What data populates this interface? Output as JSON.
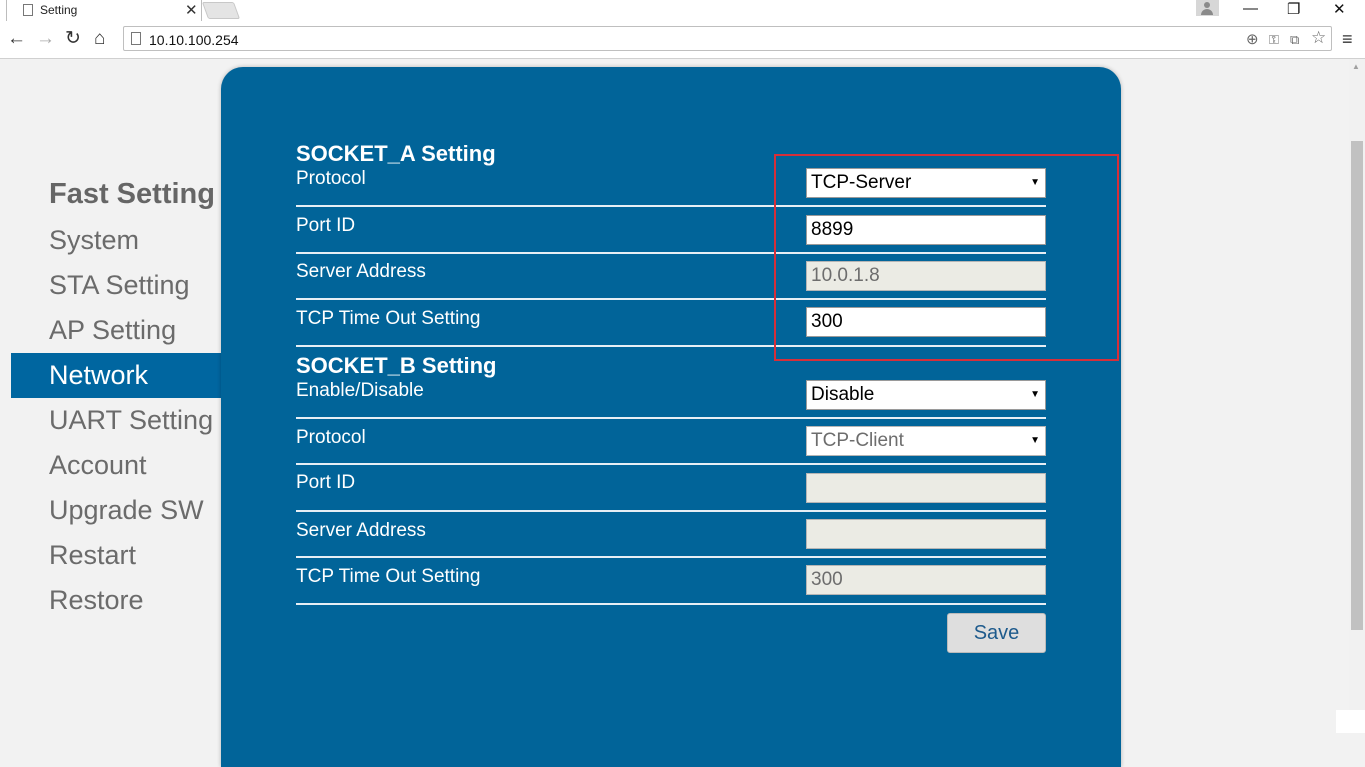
{
  "browser": {
    "tab_title": "Setting",
    "url": "10.10.100.254",
    "close_glyph": "✕",
    "minimize_glyph": "—",
    "restore_glyph": "❐",
    "win_close_glyph": "✕",
    "back_glyph": "←",
    "forward_glyph": "→",
    "reload_glyph": "↻",
    "home_glyph": "⌂",
    "menu_glyph": "≡",
    "zoom_glyph": "⊕",
    "star_glyph": "☆"
  },
  "sidebar": {
    "title": "Fast Setting",
    "items": [
      {
        "label": "System"
      },
      {
        "label": "STA Setting"
      },
      {
        "label": "AP Setting"
      },
      {
        "label": "Network"
      },
      {
        "label": "UART Setting"
      },
      {
        "label": "Account"
      },
      {
        "label": "Upgrade SW"
      },
      {
        "label": "Restart"
      },
      {
        "label": "Restore"
      }
    ]
  },
  "socket_a": {
    "title": "SOCKET_A Setting",
    "protocol_label": "Protocol",
    "protocol_value": "TCP-Server",
    "port_label": "Port ID",
    "port_value": "8899",
    "server_label": "Server Address",
    "server_value": "10.0.1.8",
    "timeout_label": "TCP Time Out Setting",
    "timeout_value": "300"
  },
  "socket_b": {
    "title": "SOCKET_B Setting",
    "enable_label": "Enable/Disable",
    "enable_value": "Disable",
    "protocol_label": "Protocol",
    "protocol_value": "TCP-Client",
    "port_label": "Port ID",
    "port_value": "",
    "server_label": "Server Address",
    "server_value": "",
    "timeout_label": "TCP Time Out Setting",
    "timeout_value": "300"
  },
  "actions": {
    "save_label": "Save"
  },
  "colors": {
    "panel": "#016499",
    "active_nav": "#0066a0",
    "highlight": "#d62f3a"
  }
}
